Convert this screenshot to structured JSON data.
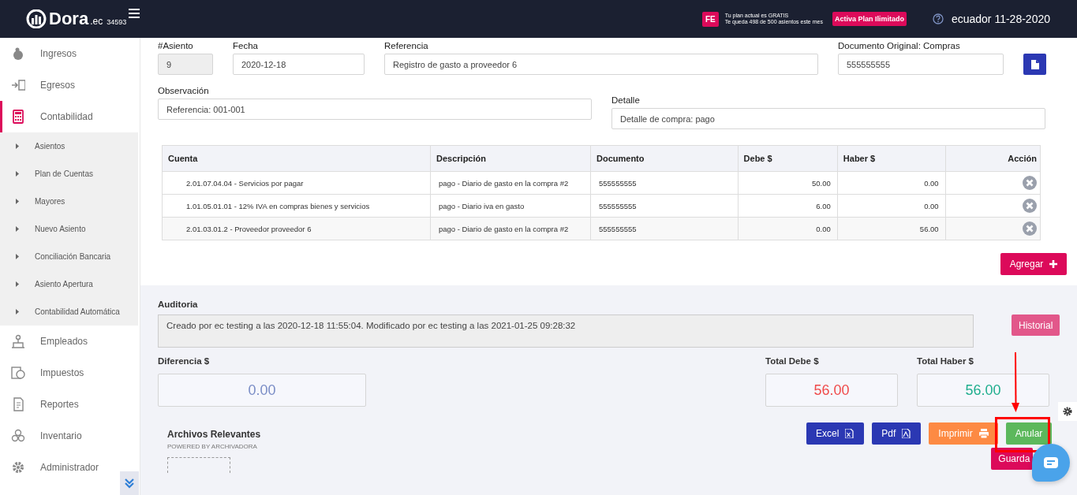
{
  "header": {
    "logo": "Dora",
    "logo_suffix": ".ec",
    "account": "34593",
    "plan_badge": "FE",
    "plan_lines": [
      "Tu plan actual es GRATIS",
      "Te queda 498 de 500 asientos este mes"
    ],
    "upgrade_button": "Activa Plan Ilimitado",
    "user": "ecuador 11-28-2020"
  },
  "sidebar": {
    "items": [
      {
        "label": "Ingresos",
        "selected": false
      },
      {
        "label": "Egresos",
        "selected": false
      },
      {
        "label": "Contabilidad",
        "selected": true,
        "expanded": true,
        "children": [
          {
            "label": "Asientos"
          },
          {
            "label": "Plan de Cuentas"
          },
          {
            "label": "Mayores"
          },
          {
            "label": "Nuevo Asiento"
          },
          {
            "label": "Conciliación Bancaria"
          },
          {
            "label": "Asiento Apertura"
          },
          {
            "label": "Contabilidad Automática"
          }
        ]
      },
      {
        "label": "Empleados",
        "selected": false
      },
      {
        "label": "Impuestos",
        "selected": false
      },
      {
        "label": "Reportes",
        "selected": false
      },
      {
        "label": "Inventario",
        "selected": false
      },
      {
        "label": "Administrador",
        "selected": false
      }
    ]
  },
  "form": {
    "asiento": {
      "label": "#Asiento",
      "value": "9"
    },
    "fecha": {
      "label": "Fecha",
      "value": "2020-12-18"
    },
    "referencia": {
      "label": "Referencia",
      "value": "Registro de gasto a proveedor 6"
    },
    "documento": {
      "label": "Documento Original: Compras",
      "value": "555555555"
    },
    "observacion": {
      "label": "Observación",
      "value": "Referencia: 001-001"
    },
    "detalle": {
      "label": "Detalle",
      "value": "Detalle de compra: pago"
    }
  },
  "table": {
    "columns": [
      "Cuenta",
      "Descripción",
      "Documento",
      "Debe $",
      "Haber $",
      "Acción"
    ],
    "rows": [
      [
        "2.01.07.04.04 - Servicios por pagar",
        "pago - Diario de gasto en la compra #2",
        "555555555",
        "50.00",
        "0.00"
      ],
      [
        "1.01.05.01.01 - 12% IVA en compras bienes y servicios",
        "pago - Diario iva en gasto",
        "555555555",
        "6.00",
        "0.00"
      ],
      [
        "2.01.03.01.2 - Proveedor proveedor 6",
        "pago - Diario de gasto en la compra #2",
        "555555555",
        "0.00",
        "56.00"
      ]
    ]
  },
  "add_button": "Agregar",
  "audit": {
    "label": "Auditoria",
    "text": "Creado por ec testing a las 2020-12-18 11:55:04. Modificado por ec testing a las 2021-01-25 09:28:32",
    "history_button": "Historial"
  },
  "totals": [
    {
      "label": "Diferencia $",
      "value": "0.00",
      "kind": "neutral"
    },
    {
      "label": "Total Debe $",
      "value": "56.00",
      "kind": "debit"
    },
    {
      "label": "Total Haber $",
      "value": "56.00",
      "kind": "credit"
    }
  ],
  "actions": [
    {
      "label": "Excel",
      "kind": "excel"
    },
    {
      "label": "Pdf",
      "kind": "pdf"
    },
    {
      "label": "Imprimir",
      "kind": "print"
    },
    {
      "label": "Anular",
      "kind": "void"
    }
  ],
  "save_button": "Guarda",
  "files": {
    "title": "Archivos Relevantes",
    "powered_by": "POWERED BY ARCHIVADORA"
  }
}
